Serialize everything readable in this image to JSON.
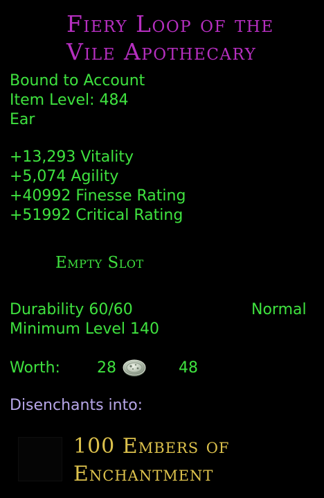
{
  "item": {
    "name_line1": "Fiery Loop of the",
    "name_line2": "Vile Apothecary",
    "binding": "Bound to Account",
    "item_level": "Item Level: 484",
    "slot": "Ear"
  },
  "stats": [
    "+13,293 Vitality",
    "+5,074 Agility",
    "+40992 Finesse Rating",
    "+51992 Critical Rating"
  ],
  "essence": {
    "label": "Empty Slot"
  },
  "info": {
    "durability": "Durability 60/60",
    "quality": "Normal",
    "min_level": "Minimum Level 140"
  },
  "worth": {
    "label": "Worth:",
    "gold": "28",
    "coin_icon": "silver-coin-icon",
    "copper": "48"
  },
  "disenchant": {
    "label": "Disenchants into:",
    "result_line1": "100 Embers of",
    "result_line2": "Enchantment"
  },
  "colors": {
    "name": "#b62fc0",
    "stat": "#3fe23f",
    "disenchant_label": "#b7a6e8",
    "result": "#dcc14c",
    "background": "#000000"
  }
}
